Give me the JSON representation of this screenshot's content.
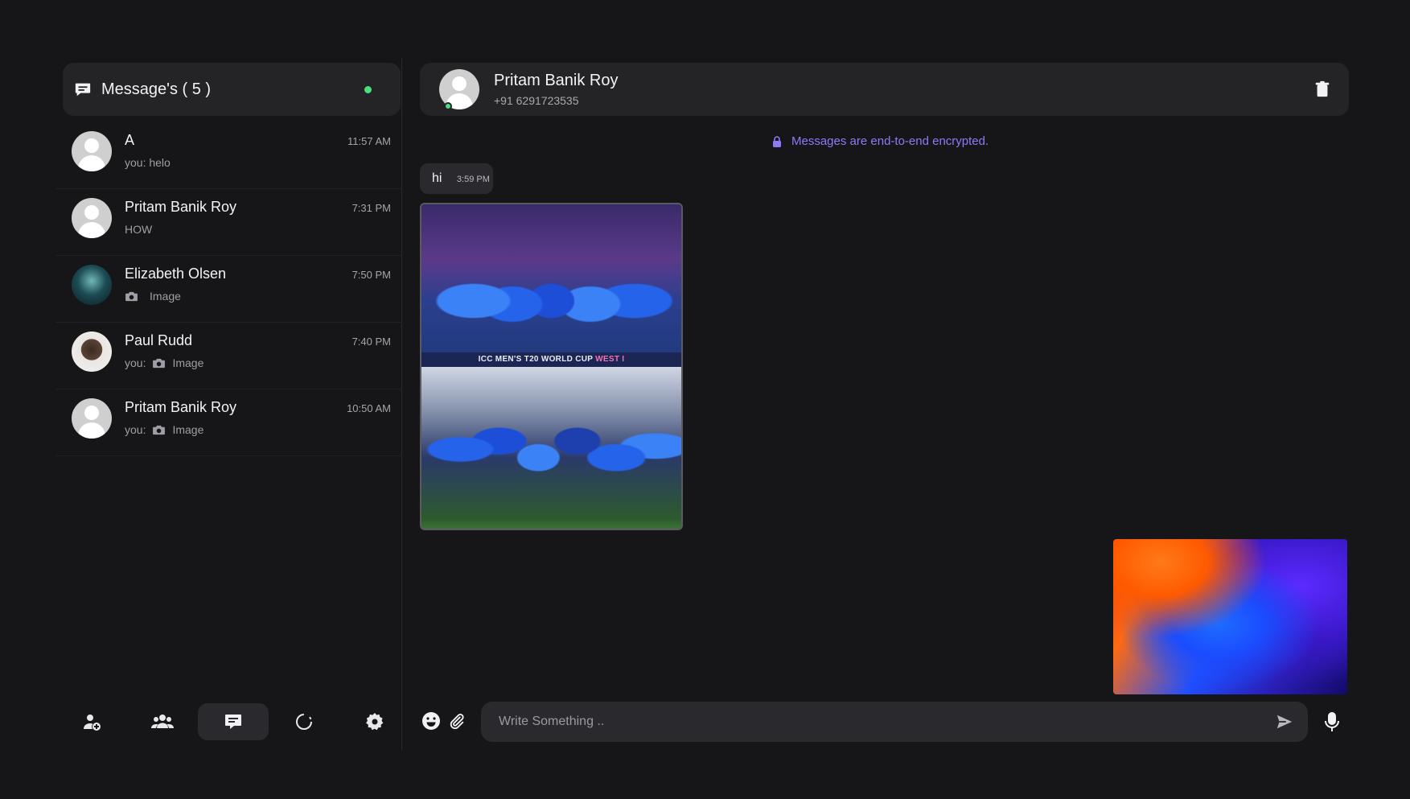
{
  "sidebar": {
    "title": "Message's ( 5 )",
    "online_color": "#4ade80",
    "chats": [
      {
        "name": "A",
        "time": "11:57 AM",
        "prefix": "you:",
        "preview": "helo",
        "avatar": "default-avatar",
        "has_image": false
      },
      {
        "name": "Pritam Banik Roy",
        "time": "7:31 PM",
        "prefix": "",
        "preview": "HOW",
        "avatar": "default-avatar",
        "has_image": false
      },
      {
        "name": "Elizabeth Olsen",
        "time": "7:50 PM",
        "prefix": "",
        "preview": "Image",
        "avatar": "photo-avatar",
        "has_image": true
      },
      {
        "name": "Paul Rudd",
        "time": "7:40 PM",
        "prefix": "you:",
        "preview": "Image",
        "avatar": "photo-avatar",
        "has_image": true
      },
      {
        "name": "Pritam Banik Roy",
        "time": "10:50 AM",
        "prefix": "you:",
        "preview": "Image",
        "avatar": "default-avatar",
        "has_image": true
      }
    ],
    "nav": [
      {
        "icon": "add-user-icon",
        "active": false
      },
      {
        "icon": "group-icon",
        "active": false
      },
      {
        "icon": "chat-icon",
        "active": true
      },
      {
        "icon": "status-icon",
        "active": false
      },
      {
        "icon": "settings-icon",
        "active": false
      }
    ]
  },
  "chat": {
    "contact_name": "Pritam Banik Roy",
    "contact_phone": "+91 6291723535",
    "encryption_notice": "Messages are end-to-end encrypted.",
    "accent_color": "#8b7cf6",
    "messages": [
      {
        "text": "hi",
        "time": "3:59 PM"
      }
    ],
    "image_caption_main": "ICC MEN'S T20 WORLD CUP",
    "image_caption_accent": "WEST I"
  },
  "composer": {
    "placeholder": "Write Something .."
  }
}
